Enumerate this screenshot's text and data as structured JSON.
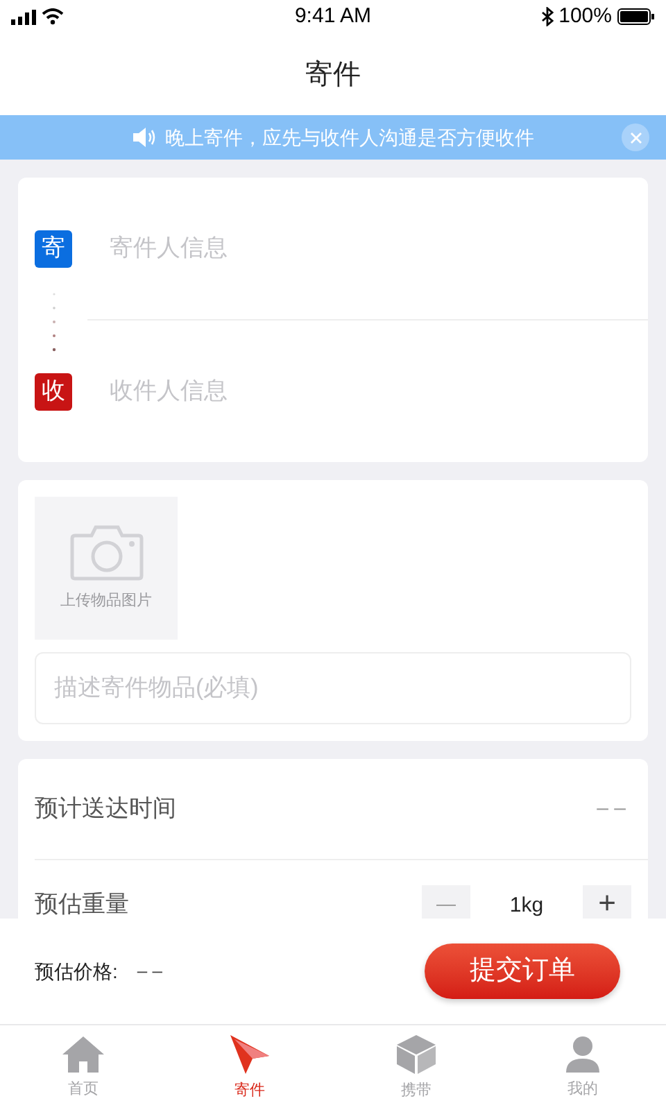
{
  "status_bar": {
    "time": "9:41 AM",
    "battery": "100%"
  },
  "title": "寄件",
  "notice": {
    "text": "晚上寄件，应先与收件人沟通是否方便收件"
  },
  "address": [
    {
      "kind": "sender",
      "badge": "寄",
      "placeholder": "寄件人信息"
    },
    {
      "kind": "receiver",
      "badge": "收",
      "placeholder": "收件人信息"
    }
  ],
  "item": {
    "upload_label": "上传物品图片",
    "description": {
      "placeholder": "描述寄件物品(必填)"
    }
  },
  "details": {
    "eta": {
      "label": "预计送达时间",
      "value": "– –"
    },
    "weight": {
      "label": "预估重量",
      "minus": "—",
      "value": "1kg",
      "plus": "+"
    }
  },
  "footer": {
    "price_label": "预估价格:",
    "price_value": "– –",
    "submit": "提交订单"
  },
  "tabs": [
    {
      "label": "首页",
      "kind": "home",
      "selected": false
    },
    {
      "label": "寄件",
      "kind": "send",
      "selected": true
    },
    {
      "label": "携带",
      "kind": "carry",
      "selected": false
    },
    {
      "label": "我的",
      "kind": "me",
      "selected": false
    }
  ]
}
